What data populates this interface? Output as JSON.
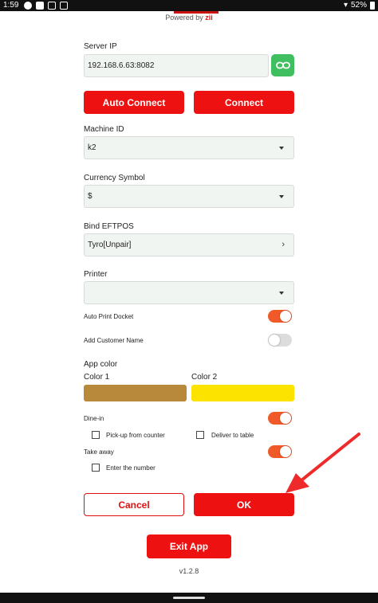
{
  "status_bar": {
    "time": "1:59",
    "battery": "52%"
  },
  "brand": {
    "powered_by": "Powered by ",
    "brand_name": "zii"
  },
  "server_ip": {
    "label": "Server IP",
    "value": "192.168.6.63:8082"
  },
  "buttons": {
    "auto_connect": "Auto Connect",
    "connect": "Connect",
    "cancel": "Cancel",
    "ok": "OK",
    "exit_app": "Exit App"
  },
  "machine_id": {
    "label": "Machine ID",
    "value": "k2"
  },
  "currency": {
    "label": "Currency Symbol",
    "value": "$"
  },
  "eftpos": {
    "label": "Bind EFTPOS",
    "value": "Tyro[Unpair]"
  },
  "printer": {
    "label": "Printer",
    "value": ""
  },
  "auto_print_docket": {
    "label": "Auto Print Docket",
    "on": true
  },
  "add_customer_name": {
    "label": "Add Customer Name",
    "on": false
  },
  "app_color": {
    "label": "App color",
    "color1_label": "Color 1",
    "color2_label": "Color 2",
    "color1": "#b8893a",
    "color2": "#fce400"
  },
  "dine_in": {
    "label": "Dine-in",
    "on": true,
    "pickup_label": "Pick-up from counter",
    "deliver_label": "Deliver to table"
  },
  "take_away": {
    "label": "Take away",
    "on": true,
    "enter_number_label": "Enter the number"
  },
  "version": "v1.2.8",
  "colors": {
    "accent_red": "#ee1111",
    "toggle_on": "#f05a28",
    "link_green": "#3fbf5f"
  }
}
